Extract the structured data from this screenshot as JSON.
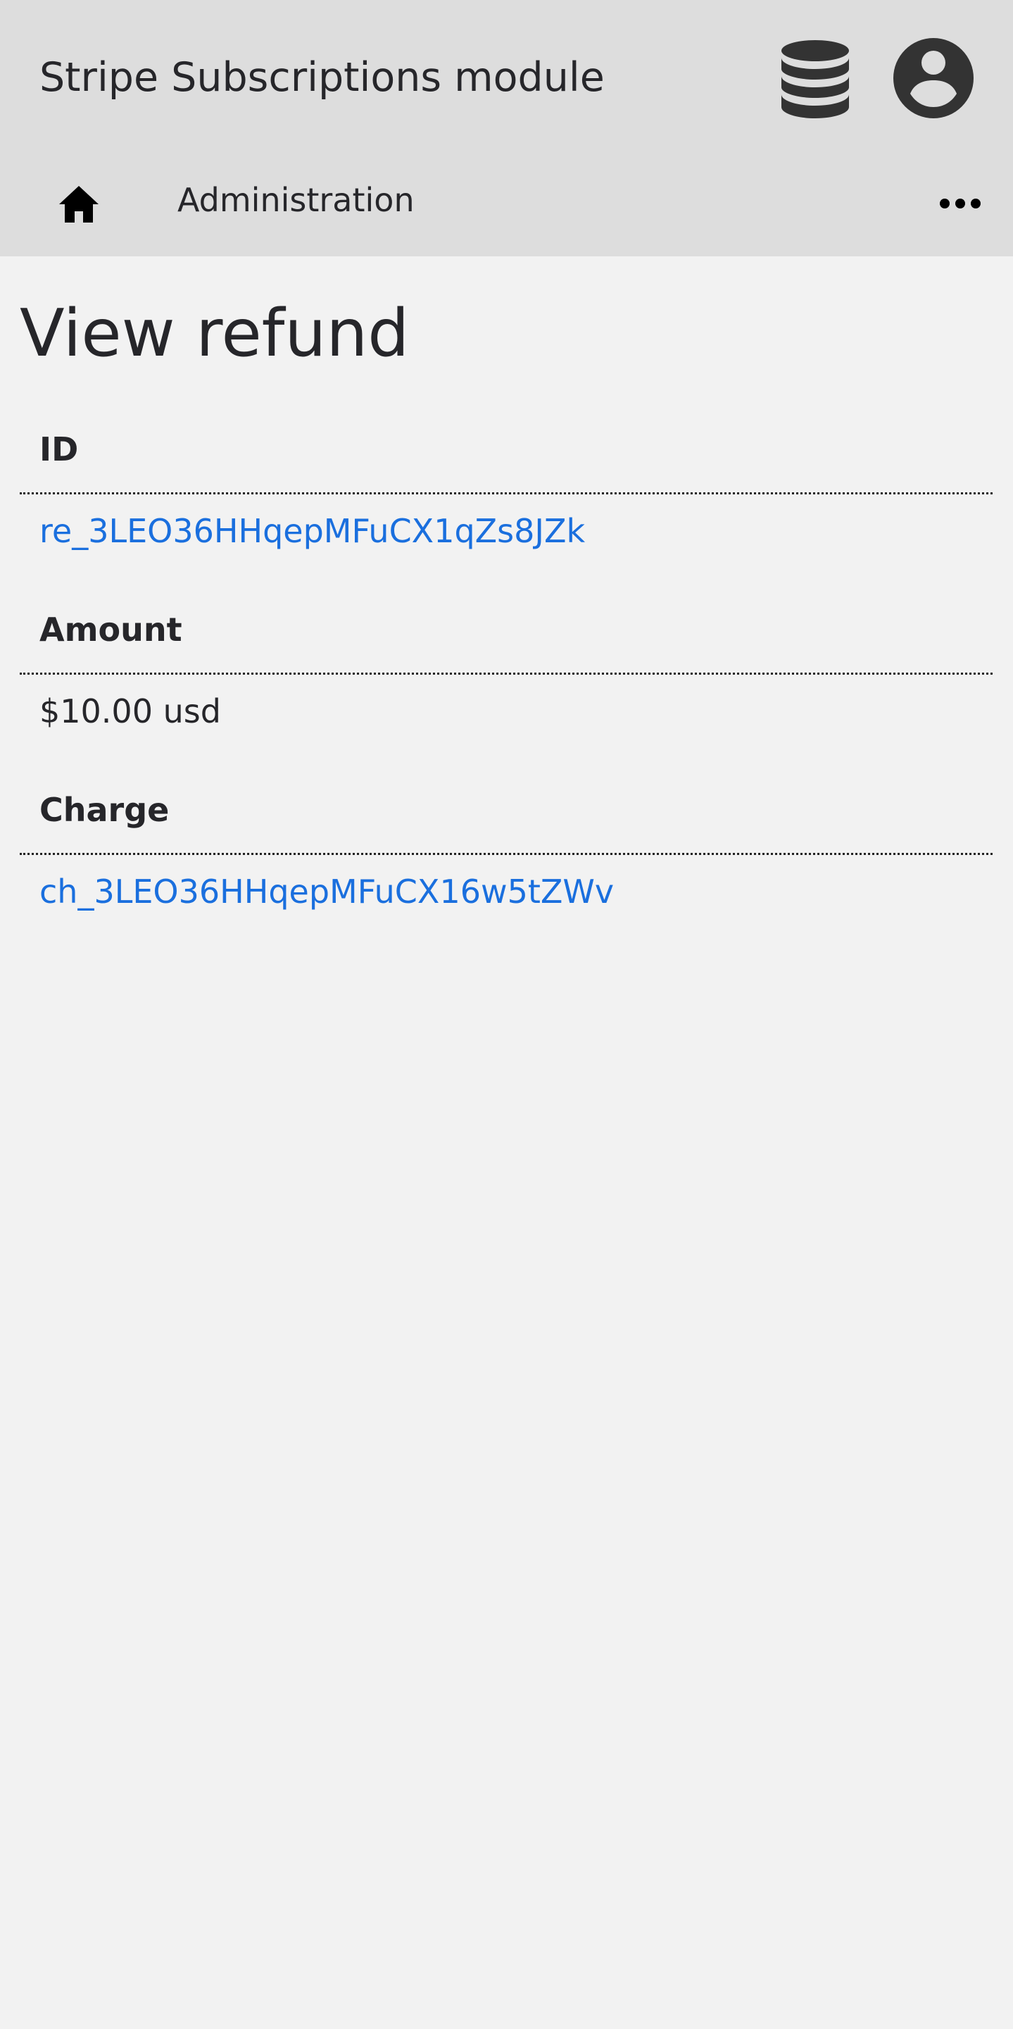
{
  "header": {
    "app_title": "Stripe Subscriptions module"
  },
  "icons": {
    "database": "database-icon",
    "user": "user-account-icon",
    "home": "home-icon",
    "more": "more-horizontal-icon"
  },
  "nav": {
    "admin_label": "Administration"
  },
  "page": {
    "title": "View refund"
  },
  "fields": {
    "id": {
      "label": "ID",
      "value": "re_3LEO36HHqepMFuCX1qZs8JZk"
    },
    "amount": {
      "label": "Amount",
      "value": "$10.00 usd"
    },
    "charge": {
      "label": "Charge",
      "value": "ch_3LEO36HHqepMFuCX16w5tZWv"
    }
  },
  "colors": {
    "header_bg": "#dddddd",
    "page_bg": "#f2f2f2",
    "link": "#1a6fde",
    "text": "#26262a",
    "icon": "#333333"
  }
}
